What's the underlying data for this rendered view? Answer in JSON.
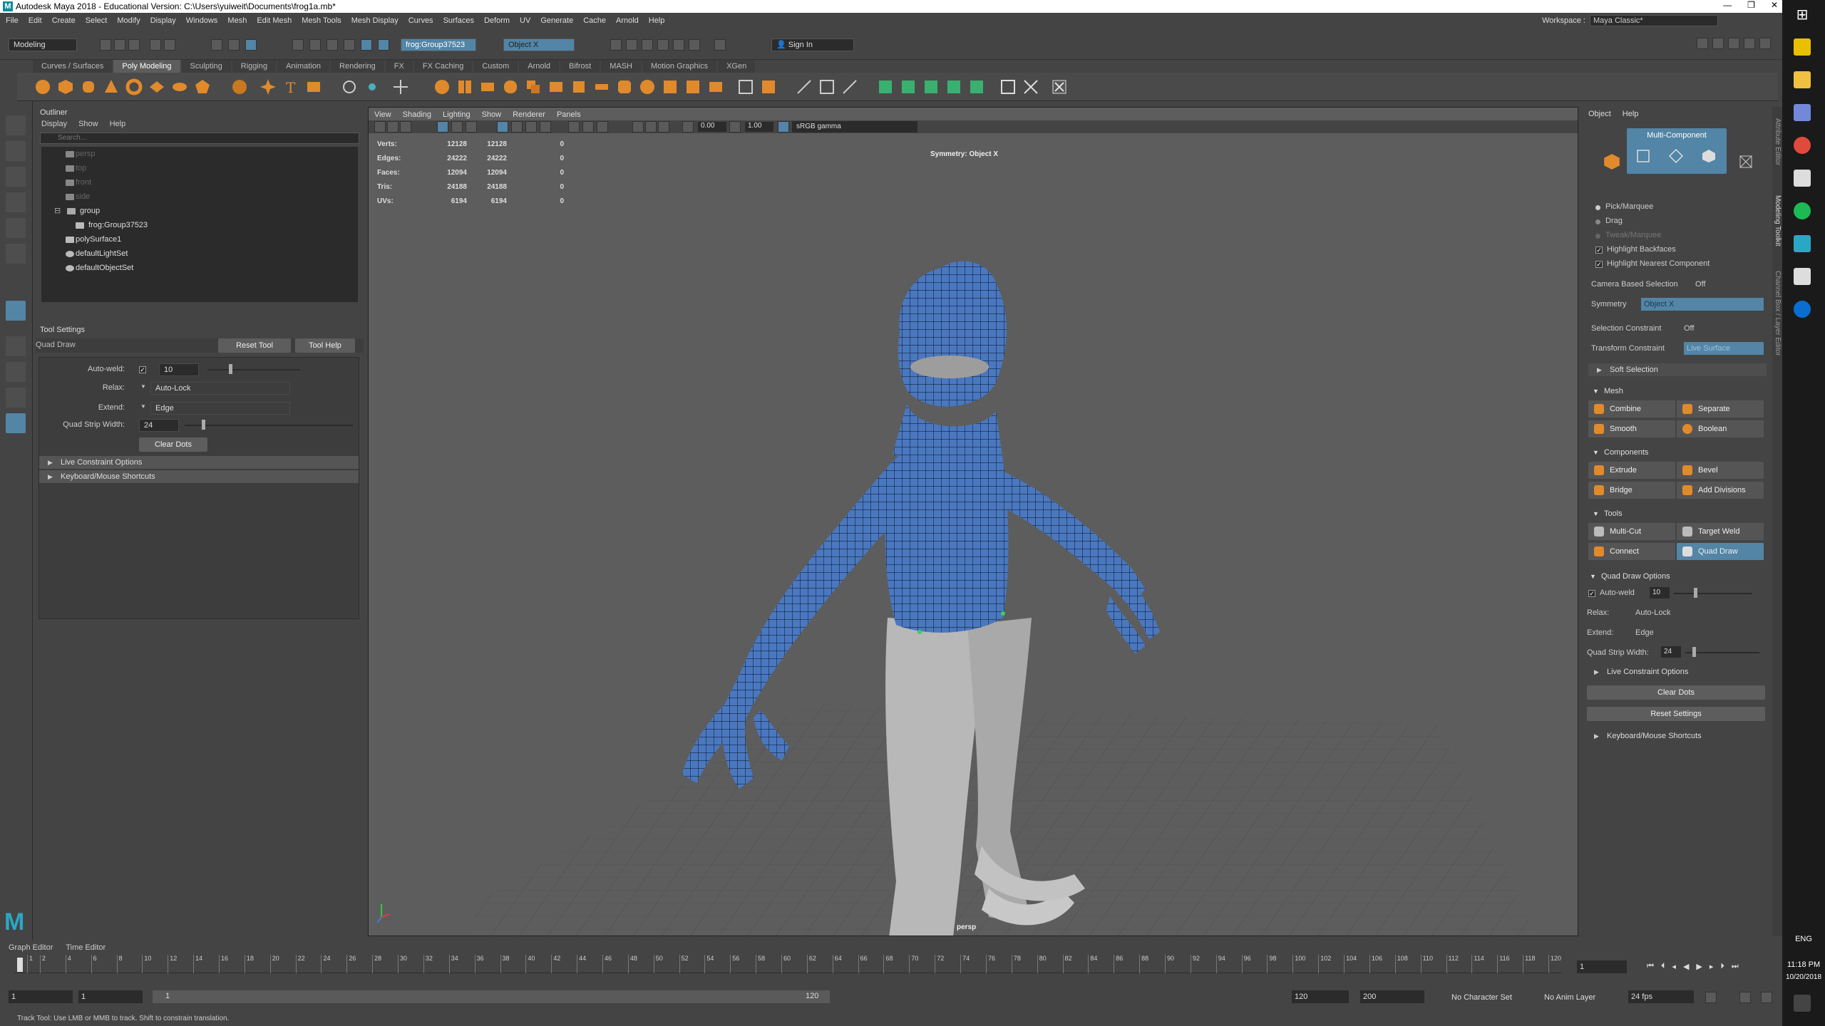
{
  "window": {
    "title": "Autodesk Maya 2018 - Educational Version: C:\\Users\\yuiweit\\Documents\\frog1a.mb*",
    "logo": "M",
    "controls": [
      "—",
      "❐",
      "✕"
    ]
  },
  "menu": [
    "File",
    "Edit",
    "Create",
    "Select",
    "Modify",
    "Display",
    "Windows",
    "Mesh",
    "Edit Mesh",
    "Mesh Tools",
    "Mesh Display",
    "Curves",
    "Surfaces",
    "Deform",
    "UV",
    "Generate",
    "Cache",
    "Arnold",
    "Help"
  ],
  "workspace": {
    "label": "Workspace :",
    "value": "Maya Classic*"
  },
  "statusline": {
    "mode": "Modeling",
    "object_field": "frog:Group37523",
    "symmetry_field": "Object X",
    "sign_in": "Sign In"
  },
  "shelf_tabs": [
    "Curves / Surfaces",
    "Poly Modeling",
    "Sculpting",
    "Rigging",
    "Animation",
    "Rendering",
    "FX",
    "FX Caching",
    "Custom",
    "Arnold",
    "Bifrost",
    "MASH",
    "Motion Graphics",
    "XGen"
  ],
  "shelf_active": "Poly Modeling",
  "colors": {
    "accent": "#5285a6",
    "mesh_blue": "#4a78c0",
    "mesh_grey": "#b8b8b8",
    "maya_orange": "#e08a2c"
  },
  "outliner": {
    "title": "Outliner",
    "menu": [
      "Display",
      "Show",
      "Help"
    ],
    "search_placeholder": "Search...",
    "items": [
      {
        "label": "persp",
        "dim": true,
        "icon": "camera-icon"
      },
      {
        "label": "top",
        "dim": true,
        "icon": "camera-icon"
      },
      {
        "label": "front",
        "dim": true,
        "icon": "camera-icon"
      },
      {
        "label": "side",
        "dim": true,
        "icon": "camera-icon"
      },
      {
        "label": "group",
        "dim": false,
        "icon": "group-icon"
      },
      {
        "label": "frog:Group37523",
        "dim": false,
        "icon": "transform-icon"
      },
      {
        "label": "polySurface1",
        "dim": false,
        "icon": "transform-icon"
      },
      {
        "label": "defaultLightSet",
        "dim": false,
        "icon": "set-icon"
      },
      {
        "label": "defaultObjectSet",
        "dim": false,
        "icon": "set-icon"
      }
    ]
  },
  "tool_settings": {
    "title": "Tool Settings",
    "tool_name": "Quad Draw",
    "reset_tool": "Reset Tool",
    "tool_help": "Tool Help",
    "auto_weld_label": "Auto-weld:",
    "auto_weld_value": "10",
    "relax_label": "Relax:",
    "relax_value": "Auto-Lock",
    "extend_label": "Extend:",
    "extend_value": "Edge",
    "strip_label": "Quad Strip Width:",
    "strip_value": "24",
    "clear_dots": "Clear Dots",
    "live_constraint": "Live Constraint Options",
    "keyboard": "Keyboard/Mouse Shortcuts"
  },
  "viewport": {
    "menu": [
      "View",
      "Shading",
      "Lighting",
      "Show",
      "Renderer",
      "Panels"
    ],
    "exposure": "0.00",
    "gamma": "1.00",
    "color_space": "sRGB gamma",
    "hud": [
      {
        "label": "Verts:",
        "a": "12128",
        "b": "12128",
        "c": "0"
      },
      {
        "label": "Edges:",
        "a": "24222",
        "b": "24222",
        "c": "0"
      },
      {
        "label": "Faces:",
        "a": "12094",
        "b": "12094",
        "c": "0"
      },
      {
        "label": "Tris:",
        "a": "24188",
        "b": "24188",
        "c": "0"
      },
      {
        "label": "UVs:",
        "a": "6194",
        "b": "6194",
        "c": "0"
      }
    ],
    "symmetry_hud": "Symmetry: Object X",
    "camera": "persp"
  },
  "modeling_toolkit": {
    "menu": [
      "Object",
      "Help"
    ],
    "multi_component": "Multi-Component",
    "pick_marquee": "Pick/Marquee",
    "drag": "Drag",
    "tweak_marquee": "Tweak/Marquee",
    "highlight_backfaces": "Highlight Backfaces",
    "highlight_nearest": "Highlight Nearest Component",
    "camera_based": "Camera Based Selection",
    "camera_based_value": "Off",
    "symmetry": "Symmetry",
    "symmetry_value": "Object X",
    "sel_constraint": "Selection Constraint",
    "sel_constraint_value": "Off",
    "transform_constraint": "Transform Constraint",
    "transform_constraint_value": "Live Surface",
    "soft_selection": "Soft Selection",
    "mesh_head": "Mesh",
    "combine": "Combine",
    "separate": "Separate",
    "smooth": "Smooth",
    "boolean": "Boolean",
    "components_head": "Components",
    "extrude": "Extrude",
    "bevel": "Bevel",
    "bridge": "Bridge",
    "add_divisions": "Add Divisions",
    "tools_head": "Tools",
    "multi_cut": "Multi-Cut",
    "target_weld": "Target Weld",
    "connect": "Connect",
    "quad_draw": "Quad Draw",
    "qd_options": "Quad Draw Options",
    "auto_weld": "Auto-weld",
    "auto_weld_value": "10",
    "relax": "Relax:",
    "relax_value": "Auto-Lock",
    "extend": "Extend:",
    "extend_value": "Edge",
    "strip": "Quad Strip Width:",
    "strip_value": "24",
    "live_constraint": "Live Constraint Options",
    "clear_dots": "Clear Dots",
    "reset_settings": "Reset Settings",
    "keyboard": "Keyboard/Mouse Shortcuts"
  },
  "side_tabs": [
    "Attribute Editor",
    "Modeling Toolkit",
    "Channel Box / Layer Editor"
  ],
  "timeline": {
    "tabs": [
      "Graph Editor",
      "Time Editor"
    ],
    "tick_labels": [
      "1",
      "2",
      "4",
      "6",
      "8",
      "10",
      "12",
      "14",
      "16",
      "18",
      "20",
      "22",
      "24",
      "26",
      "28",
      "30",
      "32",
      "34",
      "36",
      "38",
      "40",
      "42",
      "44",
      "46",
      "48",
      "50",
      "52",
      "54",
      "56",
      "58",
      "60",
      "62",
      "64",
      "66",
      "68",
      "70",
      "72",
      "74",
      "76",
      "78",
      "80",
      "82",
      "84",
      "86",
      "88",
      "90",
      "92",
      "94",
      "96",
      "98",
      "100",
      "102",
      "104",
      "106",
      "108",
      "110",
      "112",
      "114",
      "116",
      "118",
      "120"
    ],
    "current_frame": "1",
    "range_start": "1",
    "range_start2": "1",
    "range_slider_start": "1",
    "range_slider_end": "120",
    "range_end": "120",
    "anim_end": "200",
    "char_set": "No Character Set",
    "anim_layer": "No Anim Layer",
    "fps": "24 fps"
  },
  "help_line": "Track Tool: Use LMB or MMB to track. Shift to constrain translation.",
  "taskbar": {
    "lang": "ENG",
    "time": "11:18 PM",
    "date": "10/20/2018"
  }
}
